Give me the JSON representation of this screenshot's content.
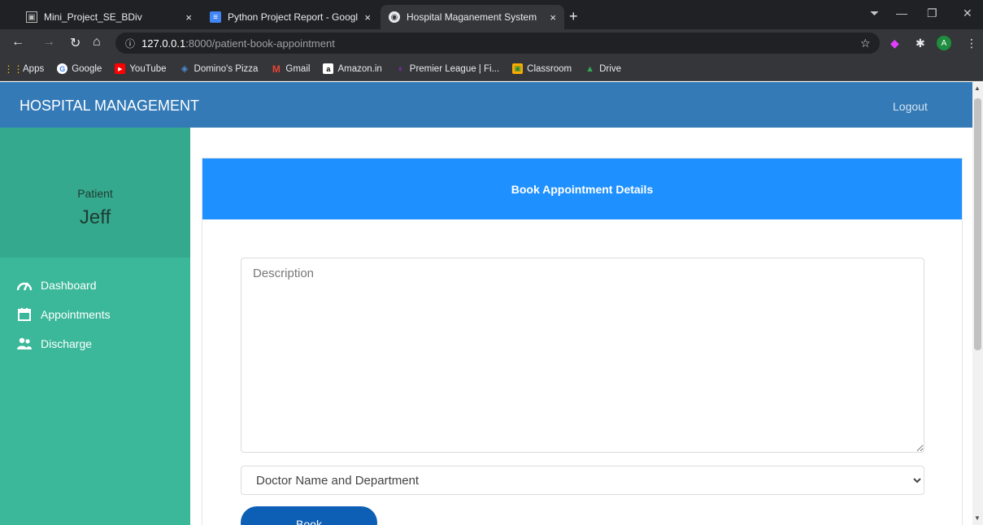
{
  "browser": {
    "tabs": [
      {
        "title": "Mini_Project_SE_BDiv",
        "active": false
      },
      {
        "title": "Python Project Report - Google D",
        "active": false
      },
      {
        "title": "Hospital Maganement System",
        "active": true
      }
    ],
    "tab_close": "×",
    "new_tab": "+",
    "window_controls": {
      "minimize": "—",
      "maximize": "❐",
      "close": "✕"
    },
    "url_host": "127.0.0.1",
    "url_path": ":8000/patient-book-appointment",
    "profile_initial": "A",
    "bookmarks": [
      {
        "label": "Apps",
        "icon": "apps-grid-icon",
        "color": "#fbbc05"
      },
      {
        "label": "Google",
        "icon": "google-icon",
        "color": "#4285f4"
      },
      {
        "label": "YouTube",
        "icon": "youtube-icon",
        "color": "#ff0000"
      },
      {
        "label": "Domino's Pizza",
        "icon": "dominos-icon",
        "color": "#006491"
      },
      {
        "label": "Gmail",
        "icon": "gmail-icon",
        "color": "#ea4335"
      },
      {
        "label": "Amazon.in",
        "icon": "amazon-icon",
        "color": "#ffffff"
      },
      {
        "label": "Premier League | Fi...",
        "icon": "premier-league-icon",
        "color": "#3d195b"
      },
      {
        "label": "Classroom",
        "icon": "classroom-icon",
        "color": "#f9ab00"
      },
      {
        "label": "Drive",
        "icon": "drive-icon",
        "color": "#34a853"
      }
    ]
  },
  "app": {
    "brand": "HOSPITAL MANAGEMENT",
    "logout": "Logout",
    "profile": {
      "role": "Patient",
      "name": "Jeff"
    },
    "menu": [
      {
        "label": "Dashboard",
        "icon": "dashboard-gauge-icon"
      },
      {
        "label": "Appointments",
        "icon": "calendar-icon"
      },
      {
        "label": "Discharge",
        "icon": "users-icon"
      }
    ],
    "form": {
      "header": "Book Appointment Details",
      "description_placeholder": "Description",
      "doctor_select_value": "Doctor Name and Department",
      "submit_label": "Book"
    }
  },
  "colors": {
    "navbar": "#337ab7",
    "sidebar": "#3bb89a",
    "card_header": "#1e90ff",
    "book_button": "#0d5fb5"
  }
}
